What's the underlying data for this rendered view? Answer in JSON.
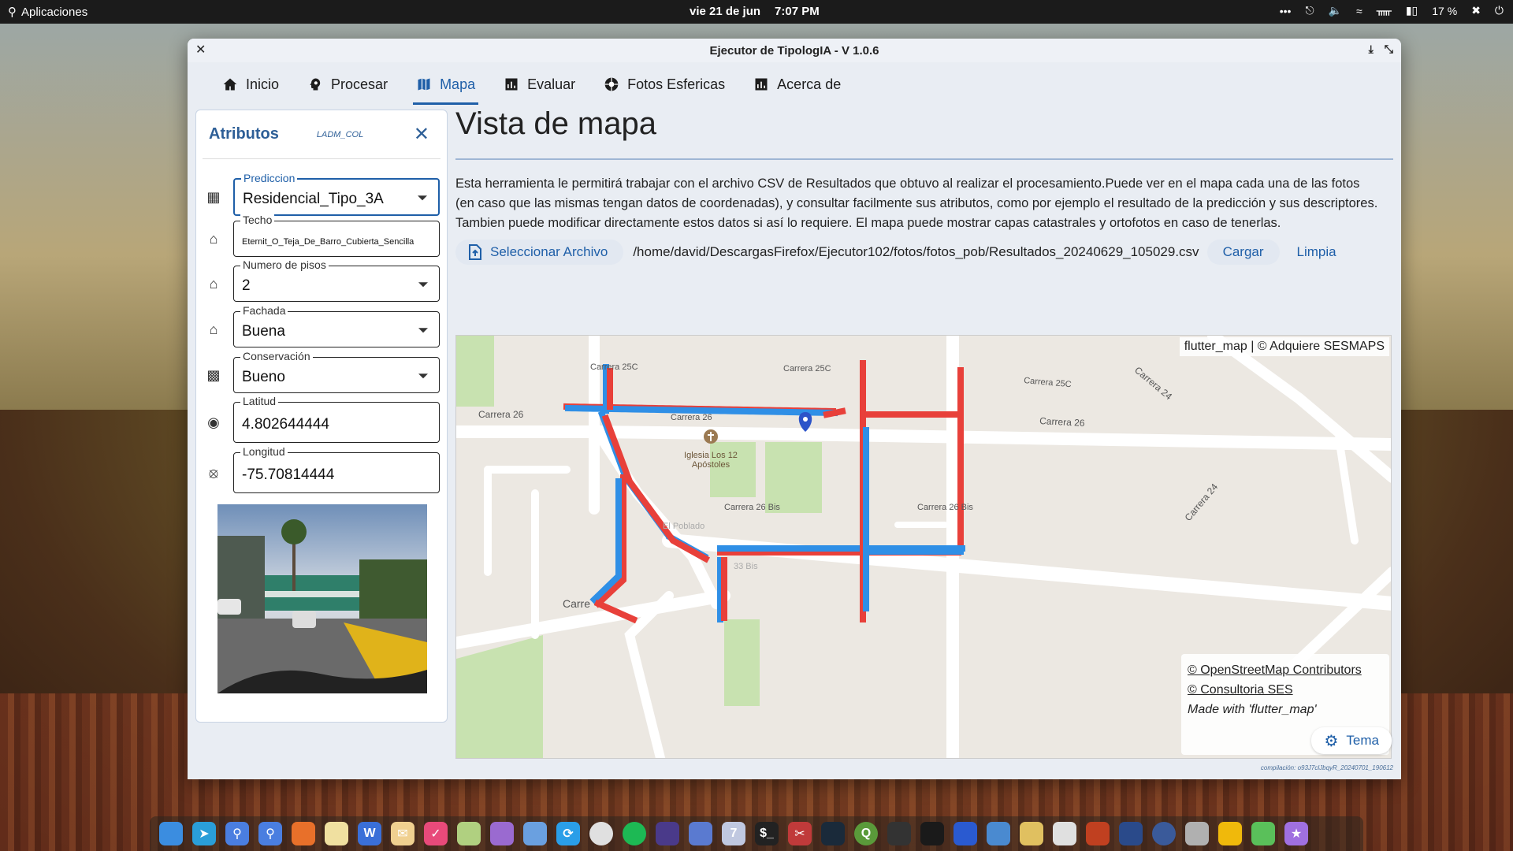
{
  "topbar": {
    "apps_label": "Aplicaciones",
    "date": "vie 21 de jun",
    "time": "7:07 PM",
    "battery": "17 %"
  },
  "window": {
    "title": "Ejecutor de TipologIA - V 1.0.6"
  },
  "tabs": [
    {
      "label": "Inicio",
      "icon": "home-icon"
    },
    {
      "label": "Procesar",
      "icon": "brain-icon"
    },
    {
      "label": "Mapa",
      "icon": "map-icon",
      "active": true
    },
    {
      "label": "Evaluar",
      "icon": "chart-icon"
    },
    {
      "label": "Fotos Esfericas",
      "icon": "camera-aperture-icon"
    },
    {
      "label": "Acerca de",
      "icon": "chart-icon"
    }
  ],
  "sidebar": {
    "title": "Atributos",
    "subtitle": "LADM_COL",
    "fields": {
      "prediccion": {
        "label": "Prediccion",
        "value": "Residencial_Tipo_3A"
      },
      "techo": {
        "label": "Techo",
        "value": "Eternit_O_Teja_De_Barro_Cubierta_Sencilla"
      },
      "pisos": {
        "label": "Numero de pisos",
        "value": "2"
      },
      "fachada": {
        "label": "Fachada",
        "value": "Buena"
      },
      "conservacion": {
        "label": "Conservación",
        "value": "Bueno"
      },
      "latitud": {
        "label": "Latitud",
        "value": "4.802644444"
      },
      "longitud": {
        "label": "Longitud",
        "value": "-75.70814444"
      }
    }
  },
  "main": {
    "title": "Vista de mapa",
    "description": "Esta herramienta le permitirá trabajar con el archivo CSV de Resultados que obtuvo al realizar el procesamiento.Puede ver en el mapa cada una de las fotos (en caso que las mismas tengan datos de coordenadas), y consultar facilmente sus atributos, como por ejemplo el resultado de la predicción y sus descriptores. Tambien puede modificar directamente estos datos si así lo requiere. El mapa puede mostrar capas catastrales y ortofotos en caso de tenerlas.",
    "select_file_label": "Seleccionar Archivo",
    "file_path": "/home/david/DescargasFirefox/Ejecutor102/fotos/fotos_pob/Resultados_20240629_105029.csv",
    "load_label": "Cargar",
    "clear_label": "Limpia"
  },
  "map": {
    "attribution_top": "flutter_map | © Adquiere SESMAPS",
    "attribution_links": [
      "© OpenStreetMap Contributors",
      "© Consultoria SES"
    ],
    "attribution_made": "Made with 'flutter_map'",
    "street_labels": {
      "carrera_25c_a": "Carrera 25C",
      "carrera_25c_b": "Carrera 25C",
      "carrera_25c_c": "Carrera 25C",
      "carrera_24": "Carrera 24",
      "carrera_26_a": "Carrera 26",
      "carrera_26_b": "Carrera 26",
      "carrera_26_c": "Carrera 26",
      "carrera_26bis_a": "Carrera 26 Bis",
      "carrera_26bis_b": "Carrera 26 Bis",
      "carrera_24b": "Carrera 24",
      "carre": "Carre",
      "poblado": "El Poblado",
      "bis33": "33 Bis"
    },
    "poi": {
      "name_line1": "Iglesia Los 12",
      "name_line2": "Apóstoles"
    },
    "colors": {
      "red": "#e8403a",
      "blue": "#2f8fe6",
      "marker": "#2c54c9"
    }
  },
  "footer": {
    "theme_label": "Tema",
    "compile_text": "compilación: o93J7clJbqyR_20240701_190612"
  }
}
